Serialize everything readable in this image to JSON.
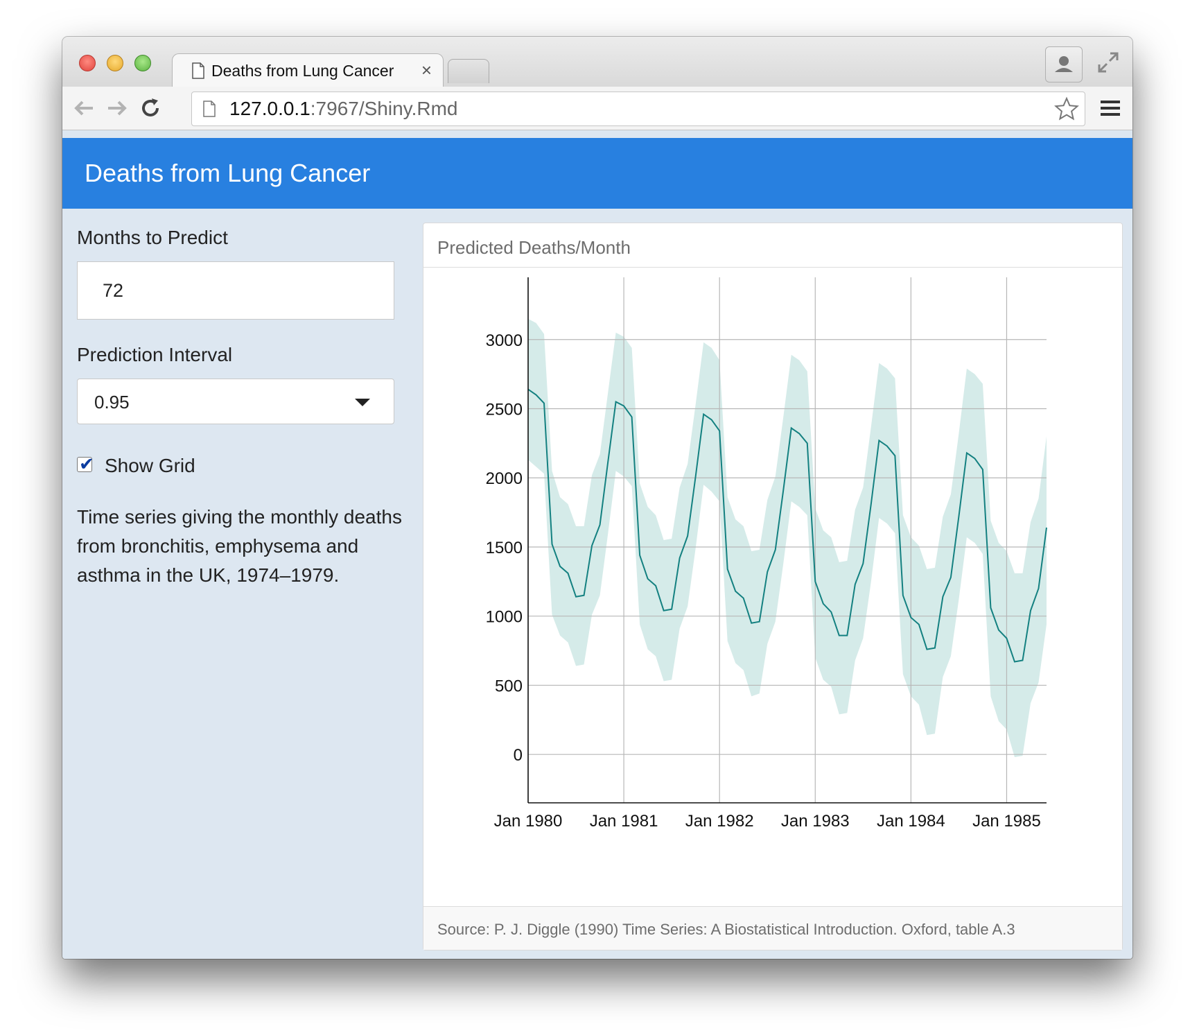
{
  "browser": {
    "tab_title": "Deaths from Lung Cancer",
    "tab_close": "×",
    "url_host": "127.0.0.1",
    "url_path": ":7967/Shiny.Rmd"
  },
  "app": {
    "title": "Deaths from Lung Cancer"
  },
  "sidebar": {
    "months_label": "Months to Predict",
    "months_value": "72",
    "interval_label": "Prediction Interval",
    "interval_value": "0.95",
    "show_grid_label": "Show Grid",
    "show_grid_checked": true,
    "description": "Time series giving the monthly deaths from bronchitis, emphysema and asthma in the UK, 1974–1979."
  },
  "card": {
    "title": "Predicted Deaths/Month",
    "source": "Source: P. J. Diggle (1990) Time Series: A Biostatistical Introduction. Oxford, table A.3"
  },
  "colors": {
    "header": "#2880e0",
    "sidebar": "#dde7f1",
    "line": "#138080",
    "band": "#d5ebe9"
  },
  "chart_data": {
    "type": "line",
    "title": "Predicted Deaths/Month",
    "x_start": "Jan 1980",
    "x_tick_labels": [
      "Jan 1980",
      "Jan 1981",
      "Jan 1982",
      "Jan 1983",
      "Jan 1984",
      "Jan 1985"
    ],
    "y_ticks": [
      0,
      500,
      1000,
      1500,
      2000,
      2500,
      3000
    ],
    "ylim": [
      -350,
      3450
    ],
    "grid": true,
    "series": [
      {
        "values": [
          2640,
          2600,
          2540,
          1520,
          1360,
          1310,
          1140,
          1150,
          1510,
          1660,
          2110,
          2550,
          2520,
          2440,
          1440,
          1270,
          1220,
          1040,
          1050,
          1420,
          1580,
          2010,
          2460,
          2420,
          2340,
          1340,
          1180,
          1130,
          950,
          960,
          1320,
          1480,
          1910,
          2360,
          2320,
          2250,
          1250,
          1090,
          1030,
          860,
          860,
          1230,
          1380,
          1810,
          2270,
          2230,
          2160,
          1150,
          990,
          940,
          760,
          770,
          1140,
          1280,
          1720,
          2180,
          2140,
          2060,
          1060,
          900,
          840,
          670,
          680,
          1040,
          1200,
          1640
        ]
      },
      {
        "values": [
          3150,
          3120,
          3040,
          2050,
          1860,
          1810,
          1650,
          1650,
          2020,
          2170,
          2610,
          3050,
          3020,
          2940,
          1960,
          1790,
          1730,
          1550,
          1560,
          1930,
          2100,
          2530,
          2980,
          2940,
          2850,
          1860,
          1700,
          1650,
          1470,
          1480,
          1840,
          2010,
          2440,
          2890,
          2850,
          2770,
          1780,
          1620,
          1570,
          1390,
          1400,
          1770,
          1930,
          2370,
          2830,
          2790,
          2720,
          1730,
          1570,
          1510,
          1340,
          1350,
          1720,
          1880,
          2320,
          2790,
          2750,
          2680,
          1690,
          1530,
          1470,
          1310,
          1310,
          1680,
          1850,
          2300
        ]
      },
      {
        "values": [
          2130,
          2080,
          2030,
          1010,
          860,
          810,
          640,
          650,
          1010,
          1150,
          1590,
          2050,
          2010,
          1940,
          940,
          760,
          710,
          530,
          540,
          910,
          1070,
          1490,
          1950,
          1900,
          1830,
          820,
          660,
          610,
          420,
          440,
          800,
          960,
          1380,
          1830,
          1790,
          1730,
          700,
          540,
          490,
          290,
          300,
          680,
          840,
          1250,
          1710,
          1670,
          1600,
          580,
          420,
          360,
          140,
          150,
          560,
          710,
          1120,
          1570,
          1530,
          1450,
          420,
          240,
          180,
          -20,
          -10,
          370,
          520,
          940
        ]
      }
    ]
  }
}
